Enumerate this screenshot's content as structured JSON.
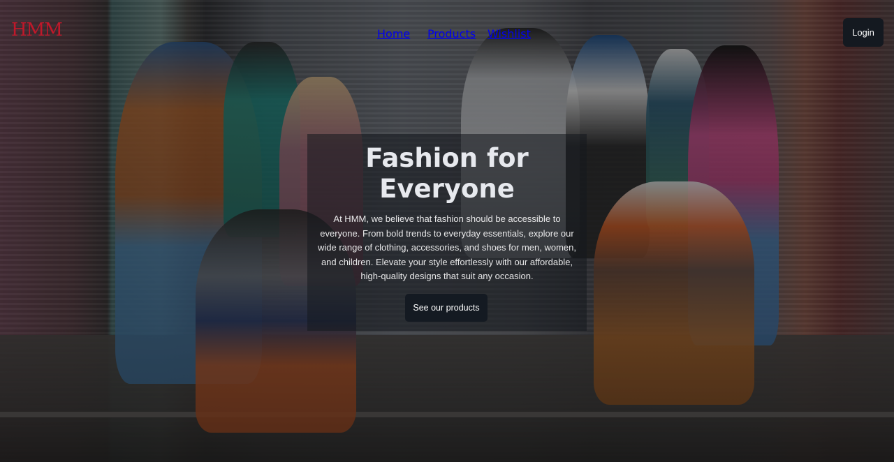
{
  "brand": {
    "logo_text": "HMM",
    "logo_color": "#c0182a"
  },
  "nav": {
    "items": [
      {
        "label": "Home"
      },
      {
        "label": "Products"
      },
      {
        "label": "Wishlist"
      }
    ],
    "login_label": "Login"
  },
  "hero": {
    "title": "Fashion for Everyone",
    "description": "At HMM, we believe that fashion should be accessible to everyone. From bold trends to everyday essentials, explore our wide range of clothing, accessories, and shoes for men, women, and children. Elevate your style effortlessly with our affordable, high-quality designs that suit any occasion.",
    "cta_label": "See our products"
  },
  "colors": {
    "button_bg": "#141920",
    "panel_overlay": "rgba(20,24,30,0.55)"
  }
}
